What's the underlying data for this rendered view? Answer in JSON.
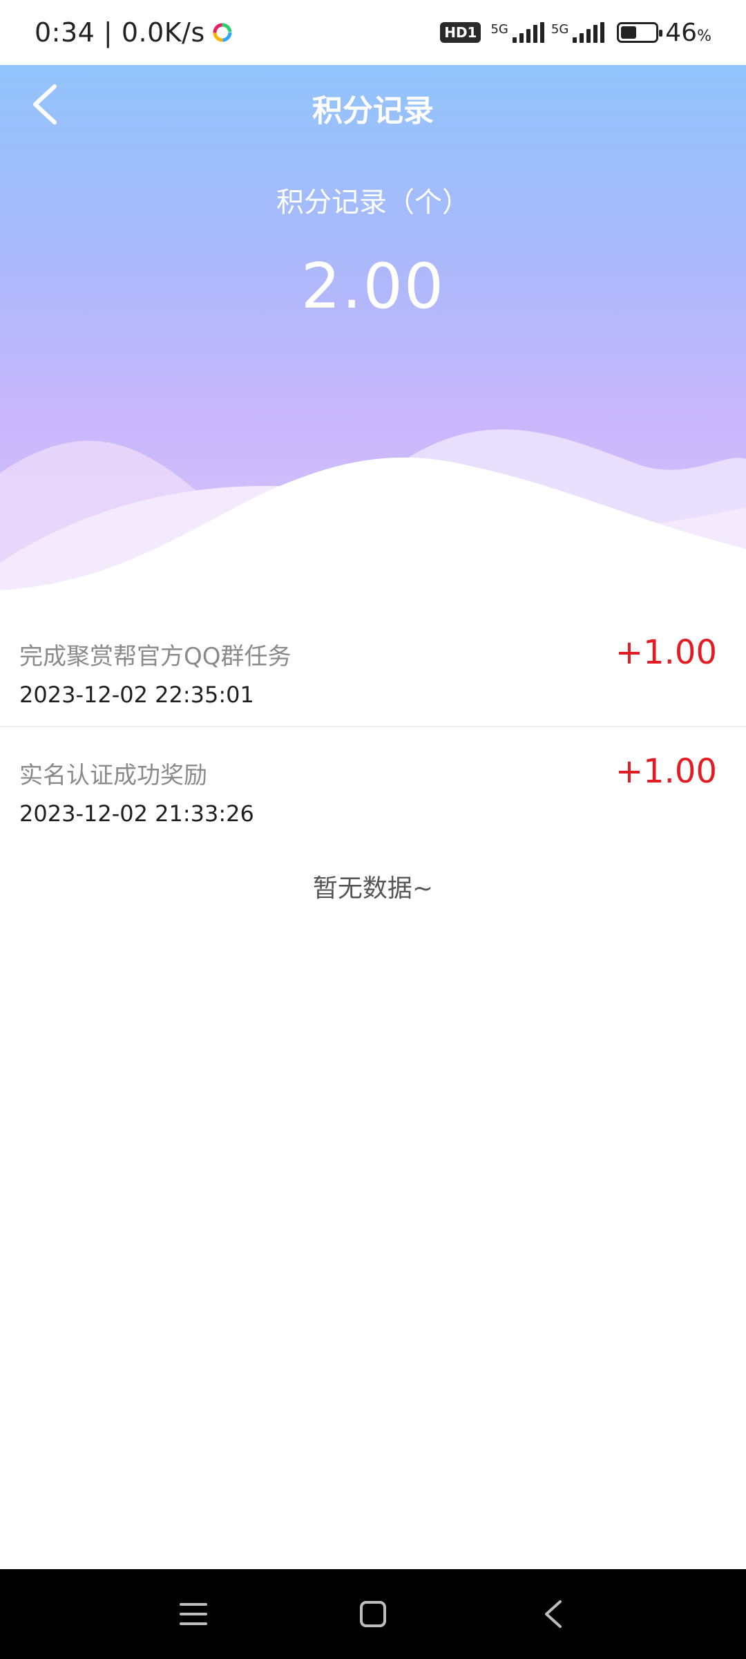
{
  "status_bar": {
    "time": "0:34",
    "net_speed": "0.0K/s",
    "hd_badge": "HD1",
    "sim1_label": "5G",
    "sim2_label": "5G",
    "battery_percent": 46,
    "battery_text": "46",
    "battery_unit": "%"
  },
  "header": {
    "title": "积分记录",
    "summary_label": "积分记录（个）",
    "summary_value": "2.00"
  },
  "records": [
    {
      "title": "完成聚赏帮官方QQ群任务",
      "time": "2023-12-02 22:35:01",
      "amount": "+1.00"
    },
    {
      "title": "实名认证成功奖励",
      "time": "2023-12-02 21:33:26",
      "amount": "+1.00"
    }
  ],
  "empty_text": "暂无数据~",
  "icons": {
    "back": "chevron-left-icon",
    "nav_menu": "menu-icon",
    "nav_home": "home-square-icon",
    "nav_back": "back-triangle-icon"
  },
  "colors": {
    "accent_red": "#e31b23",
    "gradient_top": "#92c4fc",
    "gradient_bottom": "#d9c5fb"
  }
}
